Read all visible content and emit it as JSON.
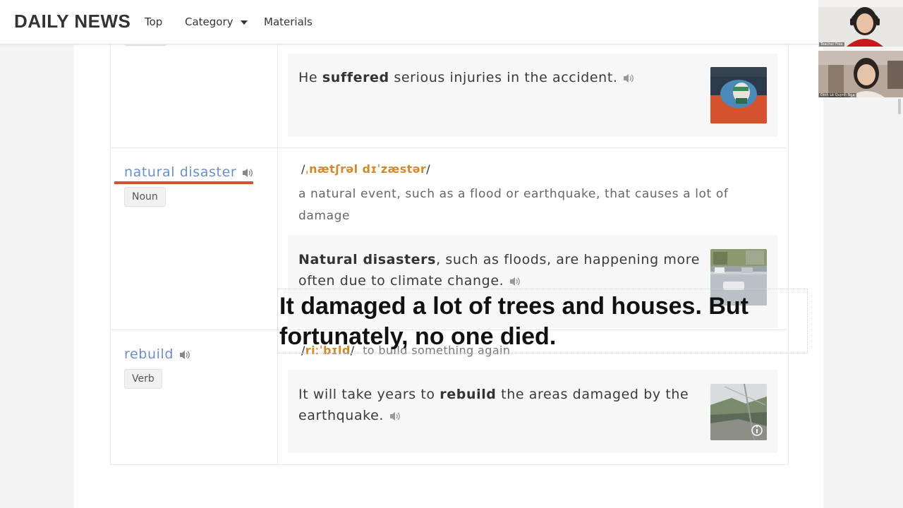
{
  "nav": {
    "brand": "DAILY NEWS",
    "links": [
      "Top",
      "Category",
      "Materials"
    ]
  },
  "entries": {
    "suffer": {
      "example_pre": "He ",
      "example_bold": "suffered",
      "example_post": " serious injuries in the accident."
    },
    "natural_disaster": {
      "word": "natural disaster",
      "pos": "Noun",
      "ipa_open": "/",
      "ipa_core": "ˌnætʃrəl dɪˈzæstər",
      "ipa_close": "/",
      "definition": "a natural event, such as a flood or earthquake, that causes a lot of damage",
      "example_bold": "Natural disasters",
      "example_post": ", such as floods, are happening more often due to climate change."
    },
    "rebuild": {
      "word": "rebuild",
      "pos": "Verb",
      "ipa_open": "/",
      "ipa_core": "riːˈbɪld",
      "ipa_close": "/",
      "definition": "to build something again",
      "example_pre": "It will take years to ",
      "example_bold": "rebuild",
      "example_post": " the areas damaged by the earthquake."
    }
  },
  "subtitle": "It damaged a lot of trees and houses. But fortunately, no one died.",
  "video": {
    "participant1": "Teacher Frea",
    "participant2": "Đinh Lê Quỳnh Nga"
  },
  "colors": {
    "word_link": "#6a8fc8",
    "ipa_accent": "#d08a2e",
    "underline": "#d8502a"
  }
}
